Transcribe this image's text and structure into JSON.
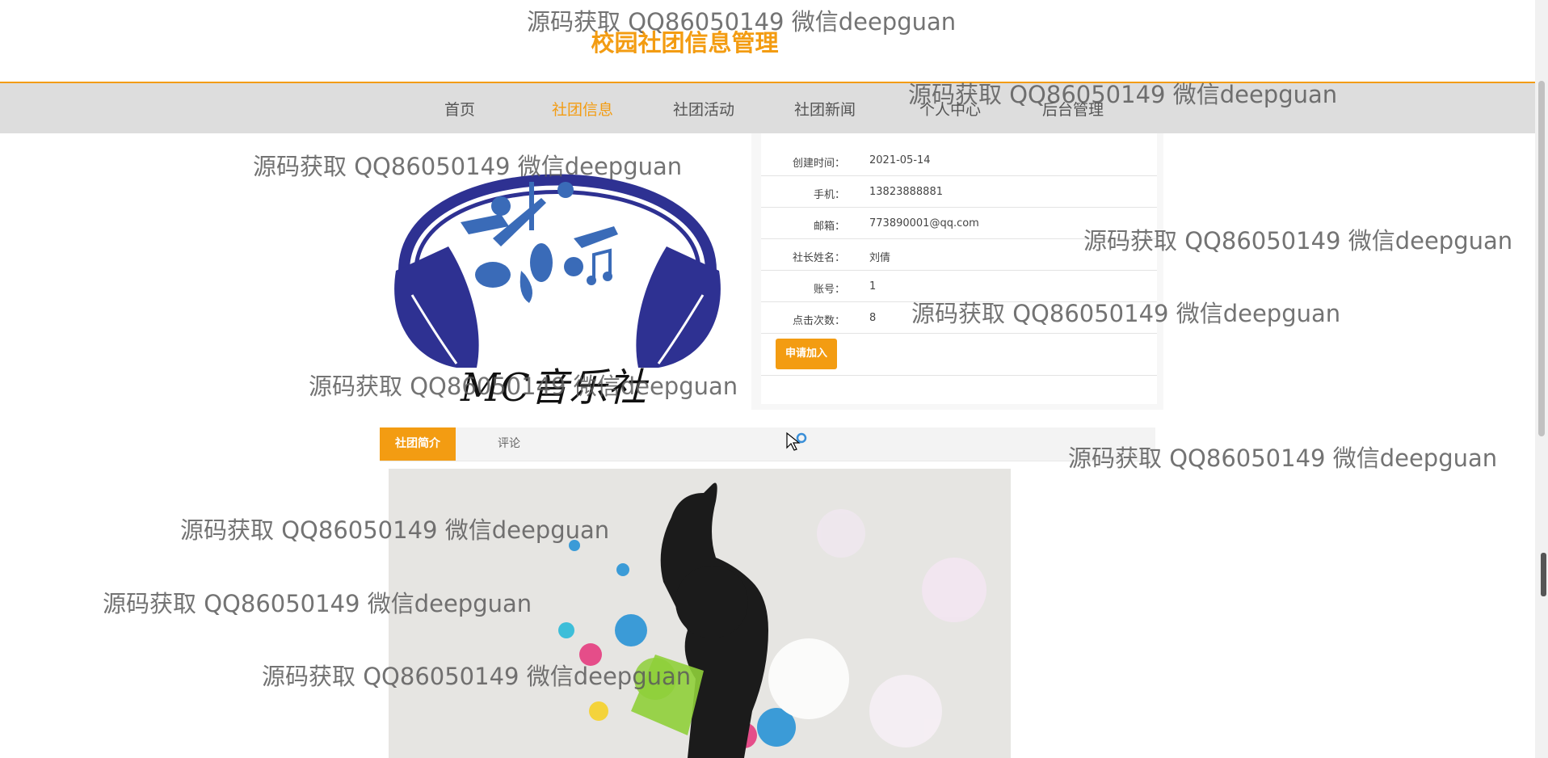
{
  "site": {
    "title": "校园社团信息管理"
  },
  "nav": {
    "items": [
      {
        "label": "首页"
      },
      {
        "label": "社团信息"
      },
      {
        "label": "社团活动"
      },
      {
        "label": "社团新闻"
      },
      {
        "label": "个人中心"
      },
      {
        "label": "后台管理"
      }
    ],
    "active_index": 1
  },
  "club": {
    "logo_caption": "MC音乐社",
    "details": [
      {
        "label": "创建时间：",
        "value": "2021-05-14"
      },
      {
        "label": "手机：",
        "value": "13823888881"
      },
      {
        "label": "邮箱：",
        "value": "773890001@qq.com"
      },
      {
        "label": "社长姓名：",
        "value": "刘倩"
      },
      {
        "label": "账号：",
        "value": "1"
      },
      {
        "label": "点击次数：",
        "value": "8"
      }
    ],
    "join_button": "申请加入"
  },
  "tabs": [
    {
      "label": "社团简介",
      "active": true
    },
    {
      "label": "评论",
      "active": false
    }
  ],
  "watermark": {
    "text": "源码获取 QQ86050149 微信deepguan"
  },
  "colors": {
    "accent": "#f39c12",
    "nav_bg": "#dddddd",
    "logo_blue": "#2e3192"
  },
  "icons": {
    "cursor": "mouse-pointer-icon",
    "scrollbar": "scrollbar-thumb"
  }
}
